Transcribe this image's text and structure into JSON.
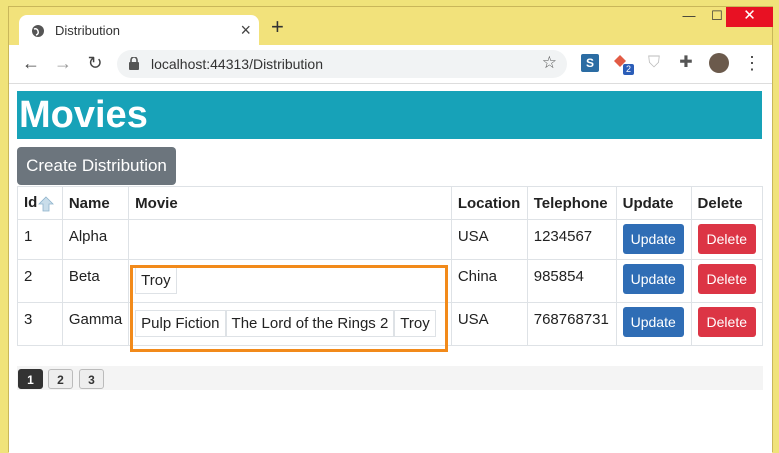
{
  "browser": {
    "tab_title": "Distribution",
    "tab_close": "×",
    "new_tab": "+",
    "url": "localhost:44313/Distribution",
    "window_controls": {
      "minimize": "—",
      "maximize": "☐",
      "close": "✕"
    },
    "extension_badge": "2",
    "extension_s": "S"
  },
  "page": {
    "title": "Movies",
    "create_button": "Create Distribution"
  },
  "table": {
    "columns": [
      "Id",
      "Name",
      "Movie",
      "Location",
      "Telephone",
      "Update",
      "Delete"
    ],
    "rows": [
      {
        "id": "1",
        "name": "Alpha",
        "movies": [],
        "location": "USA",
        "telephone": "1234567",
        "update": "Update",
        "delete": "Delete"
      },
      {
        "id": "2",
        "name": "Beta",
        "movies": [
          "Troy"
        ],
        "location": "China",
        "telephone": "985854",
        "update": "Update",
        "delete": "Delete"
      },
      {
        "id": "3",
        "name": "Gamma",
        "movies": [
          "Pulp Fiction",
          "The Lord of the Rings 2",
          "Troy"
        ],
        "location": "USA",
        "telephone": "768768731",
        "update": "Update",
        "delete": "Delete"
      }
    ]
  },
  "pagination": {
    "pages": [
      "1",
      "2",
      "3"
    ],
    "active": "1"
  },
  "colors": {
    "banner": "#17a2b8",
    "update_button": "#2f6db5",
    "delete_button": "#dc3545",
    "create_button": "#6c757d",
    "highlight": "#f28a1a"
  }
}
